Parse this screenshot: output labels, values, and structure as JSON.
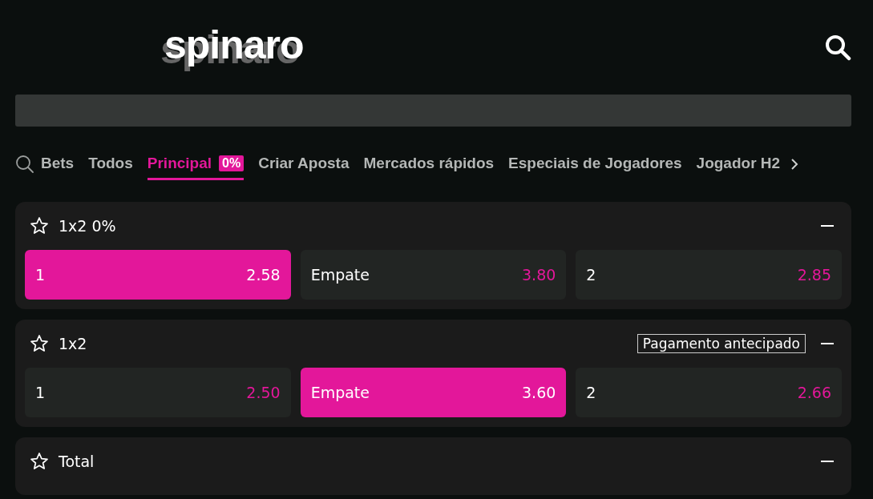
{
  "header": {
    "logo": "spinaro"
  },
  "tabs": [
    {
      "label": "Bets",
      "selected": false
    },
    {
      "label": "Todos",
      "selected": false
    },
    {
      "label": "Principal",
      "badge": "0%",
      "selected": true
    },
    {
      "label": "Criar Aposta",
      "selected": false
    },
    {
      "label": "Mercados rápidos",
      "selected": false
    },
    {
      "label": "Especiais de Jogadores",
      "selected": false
    },
    {
      "label": "Jogador H2",
      "selected": false
    }
  ],
  "markets": [
    {
      "title": "1x2 0%",
      "expanded": true,
      "outcomes": [
        {
          "label": "1",
          "odds": "2.58",
          "selected": true
        },
        {
          "label": "Empate",
          "odds": "3.80",
          "selected": false
        },
        {
          "label": "2",
          "odds": "2.85",
          "selected": false
        }
      ]
    },
    {
      "title": "1x2",
      "tag": "Pagamento antecipado",
      "expanded": true,
      "outcomes": [
        {
          "label": "1",
          "odds": "2.50",
          "selected": false
        },
        {
          "label": "Empate",
          "odds": "3.60",
          "selected": true
        },
        {
          "label": "2",
          "odds": "2.66",
          "selected": false
        }
      ]
    },
    {
      "title": "Total",
      "expanded": true
    }
  ]
}
